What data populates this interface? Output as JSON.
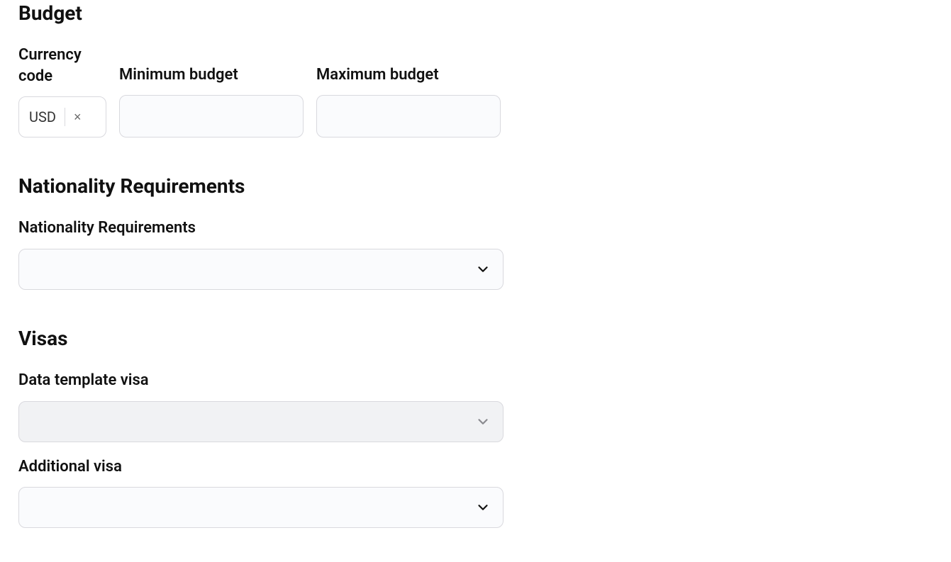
{
  "budget": {
    "title": "Budget",
    "currency_label_line1": "Currency",
    "currency_label_line2": "code",
    "currency_value": "USD",
    "min_label": "Minimum budget",
    "min_value": "",
    "max_label": "Maximum budget",
    "max_value": ""
  },
  "nationality": {
    "title": "Nationality Requirements",
    "field_label": "Nationality Requirements",
    "value": ""
  },
  "visas": {
    "title": "Visas",
    "data_template_label": "Data template visa",
    "data_template_value": "",
    "additional_label": "Additional visa",
    "additional_value": ""
  }
}
